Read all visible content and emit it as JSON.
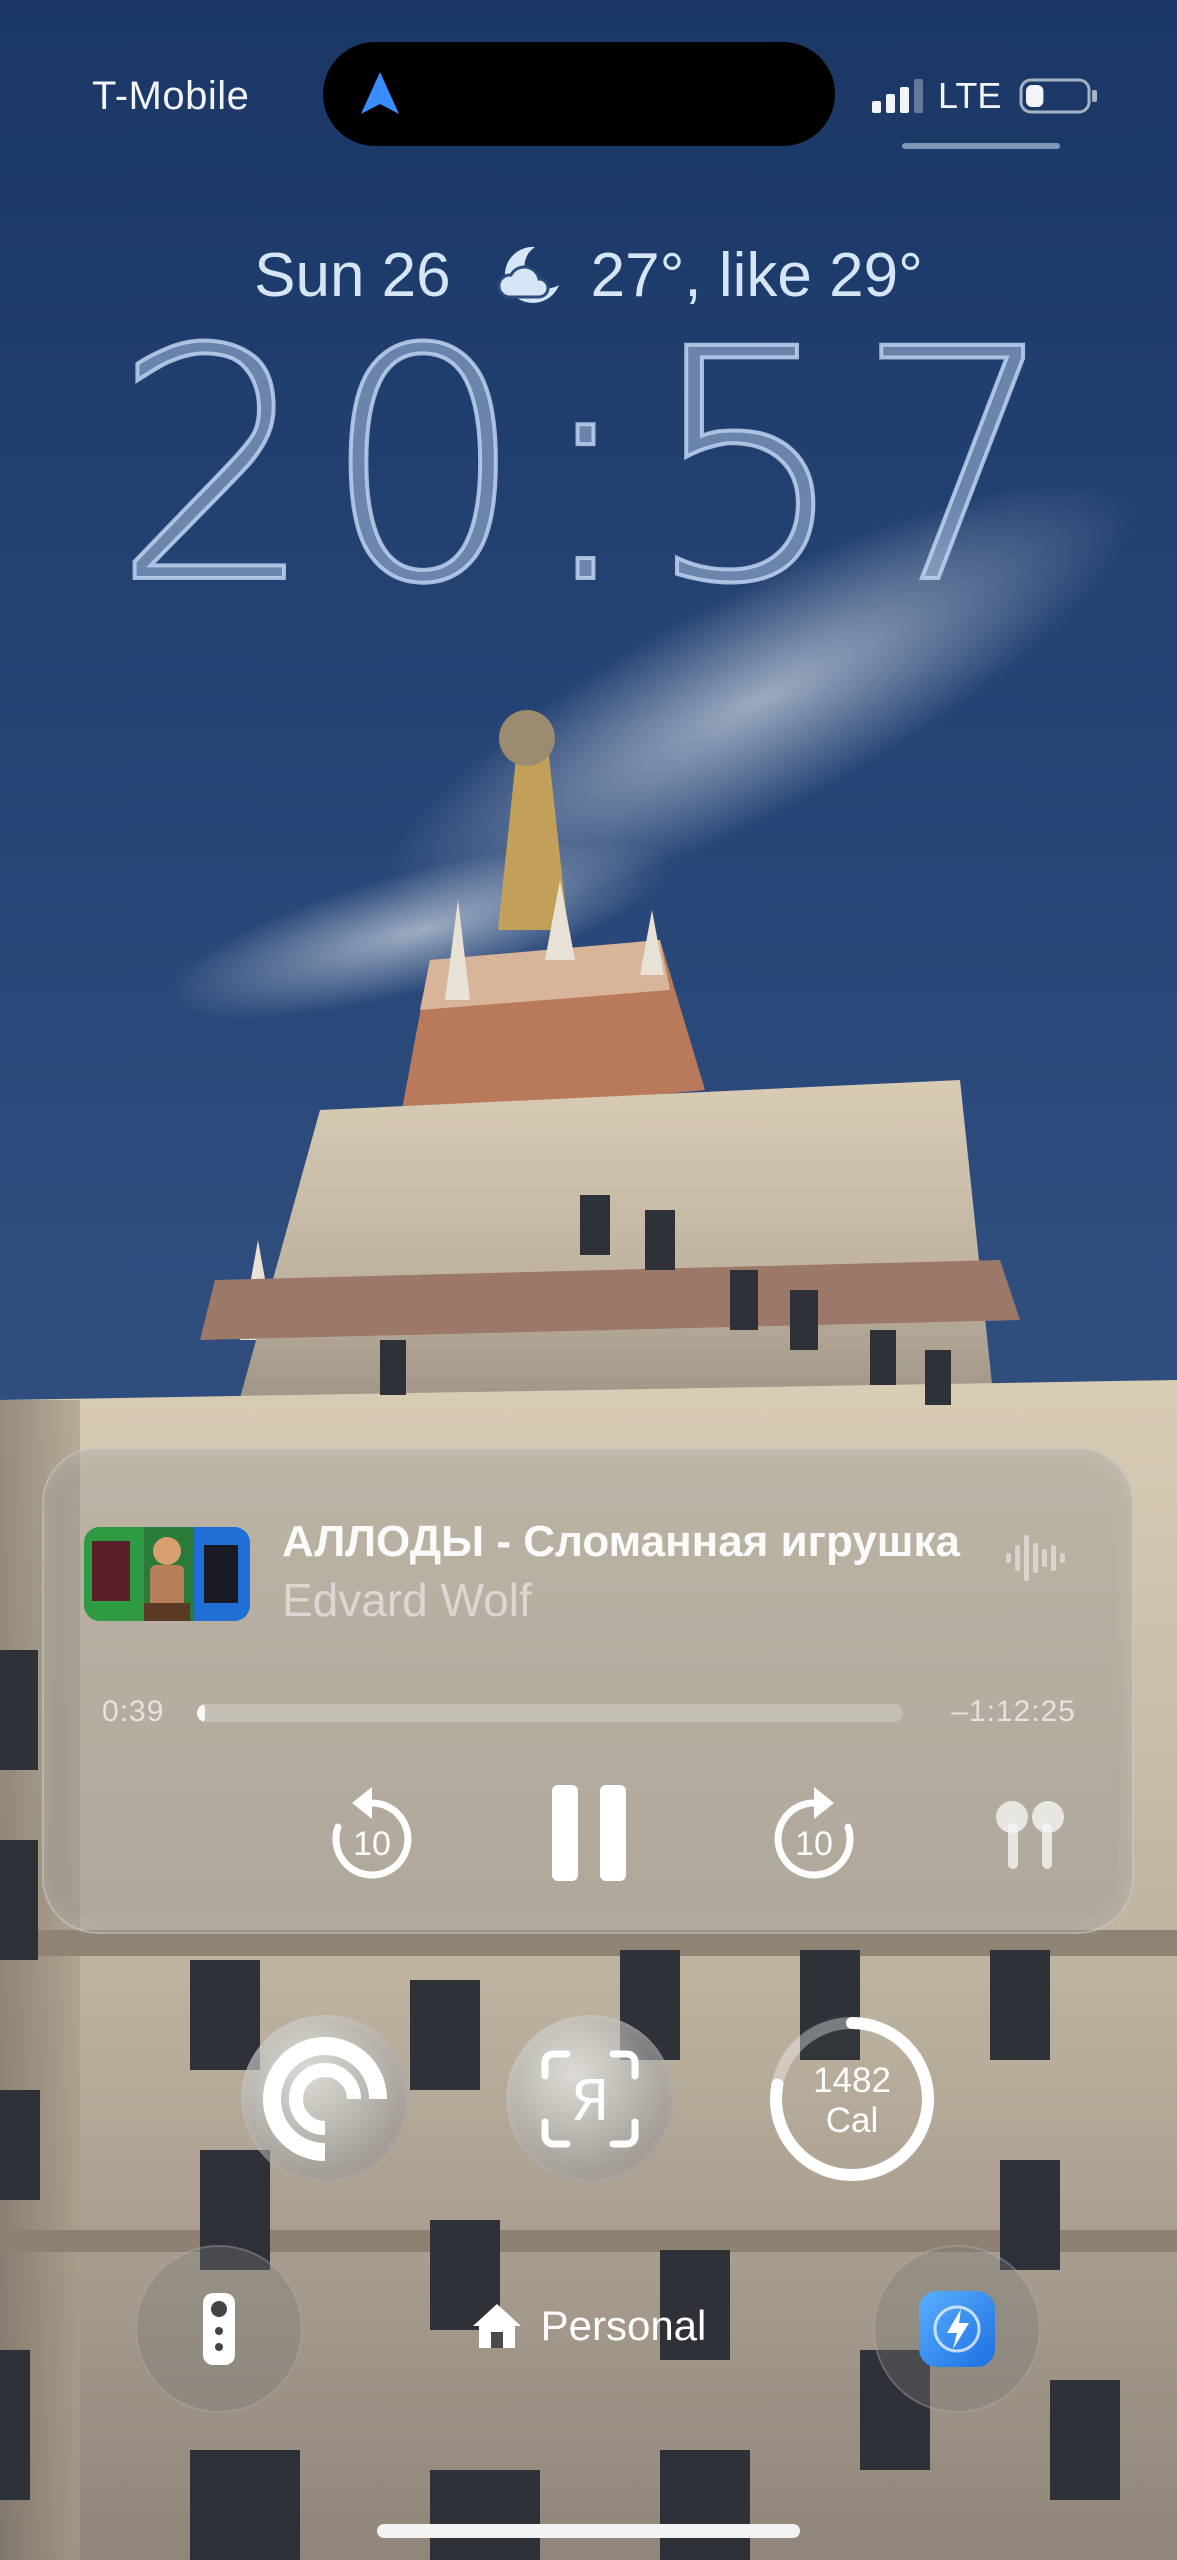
{
  "status_bar": {
    "carrier": "T-Mobile",
    "network": "LTE",
    "signal_bars_filled": 3,
    "signal_bars_total": 4,
    "battery_level": 0.3,
    "live_activity_icon": "navigation-arrow-icon"
  },
  "lock_screen": {
    "date": "Sun 26",
    "weather_icon": "partly-cloudy-night-icon",
    "weather_text": "27°, like 29°",
    "time": "20:57"
  },
  "now_playing": {
    "title": "АЛЛОДЫ - Сломанная игрушка",
    "artist": "Edvard Wolf",
    "elapsed": "0:39",
    "remaining": "–1:12:25",
    "progress": 0.009,
    "skip_back_seconds": "10",
    "skip_forward_seconds": "10",
    "output_device_icon": "airpods-icon"
  },
  "widgets": {
    "pocket_icon": "pocket-casts-icon",
    "yandex_icon": "yandex-icon",
    "yandex_glyph": "Я",
    "calories_value": "1482",
    "calories_unit": "Cal",
    "calories_progress": 0.78
  },
  "bottom": {
    "left_button_icon": "tv-remote-icon",
    "focus_icon": "house-icon",
    "focus_label": "Personal",
    "right_button_icon": "shortcuts-app-icon"
  },
  "colors": {
    "sky_top": "#1a3766",
    "sky_bottom": "#2f4f80",
    "nav_blue": "#3a8dff",
    "clock_fill": "#a8bede"
  }
}
